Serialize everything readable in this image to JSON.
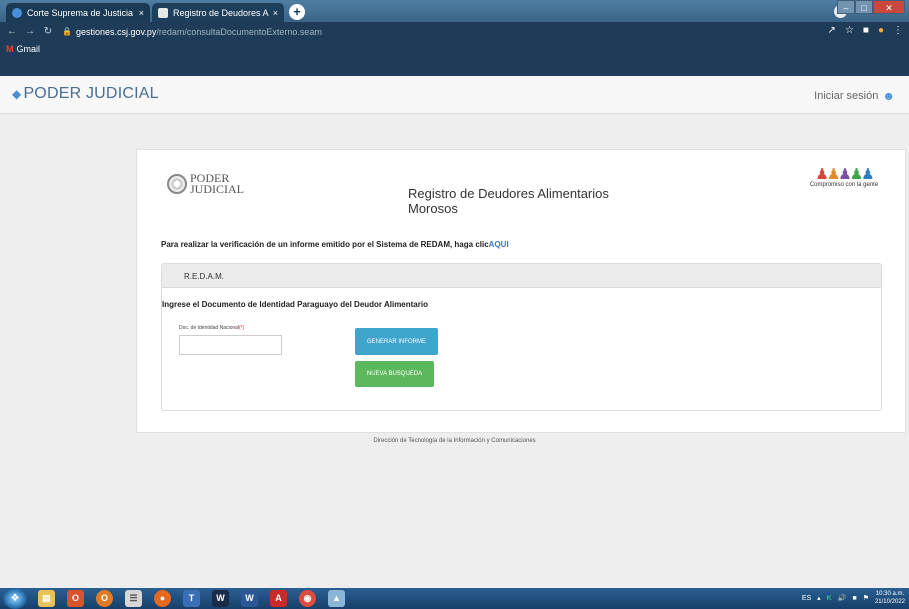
{
  "browser": {
    "tabs": [
      {
        "label": "Corte Suprema de Justicia - Pode",
        "favicon": "globe-icon"
      },
      {
        "label": "Registro de Deudores Alimentari",
        "favicon": "document-icon"
      }
    ],
    "close_glyph": "×",
    "new_tab_glyph": "+",
    "url_domain": "gestiones.csj.gov.py",
    "url_path": "/redam/consultaDocumentoExterno.seam",
    "bookmark": "Gmail"
  },
  "header": {
    "brand": "PODER JUDICIAL",
    "login": "Iniciar sesión"
  },
  "card": {
    "logo_line1": "PODER",
    "logo_line2": "JUDICIAL",
    "title": "Registro de Deudores Alimentarios Morosos",
    "tagline": "Compromiso con la gente",
    "verify_text": "Para realizar la verificación de un informe emitido por el Sistema de REDAM, haga clic",
    "verify_link": "AQUI",
    "panel_title": "R.E.D.A.M.",
    "panel_subtitle": "Ingrese el Documento de Identidad Paraguayo del Deudor Alimentario",
    "doc_label": "Doc. de Identidad Nacional",
    "doc_required": "(*)",
    "doc_value": "",
    "btn_generate": "GENERAR INFORME",
    "btn_new": "NUEVA BUSQUEDA"
  },
  "footer": "Dirección de Tecnología de la Información y Comunicaciones",
  "taskbar": {
    "lang": "ES",
    "time": "10:30 a.m.",
    "date": "21/10/2022"
  },
  "colors": {
    "browser_dark": "#1e3c57",
    "brand_blue": "#4a6e90",
    "link_blue": "#2a7ec6",
    "btn_generate": "#3ea6cd",
    "btn_new": "#5cb85c"
  }
}
